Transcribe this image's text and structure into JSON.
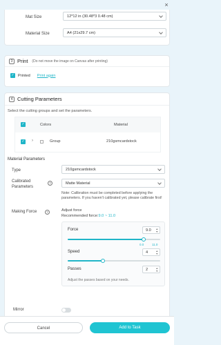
{
  "window": {
    "close_icon": "×"
  },
  "mat": {
    "mat_size_label": "Mat Size",
    "mat_size_value": "12*12 in (30.48*3 0.48 cm)",
    "material_size_label": "Material Size",
    "material_size_value": "A4 (21x29.7 cm)"
  },
  "print": {
    "number": "3",
    "title": "Print",
    "hint": "(Do not move the image on Canvas after printing)",
    "printed_label": "Printed",
    "print_again": "Print again"
  },
  "cutting": {
    "number": "4",
    "title": "Cutting Parameters",
    "subtitle": "Select the cutting groups and set the parameters.",
    "columns": [
      "Colors",
      "Material"
    ],
    "rows": [
      {
        "group": "Group",
        "material": "210gsmcardstock"
      }
    ]
  },
  "params": {
    "title": "Material Parameters",
    "type_label": "Type",
    "type_value": "210gsmcardstock",
    "calibrated_label": "Calibrated Parameters",
    "calibrated_value": "Matte Material",
    "note": "Note: Calibration must be completed before applying the parameters. If you haven't calibrated yet, please calibrate first!",
    "making_force_label": "Making Force",
    "adjust_force": "Adjust force",
    "recommended_prefix": "Recommended force:",
    "recommended_range": "9.0 ~ 11.0",
    "force_label": "Force",
    "force_value": "9.0",
    "force_min": "0.0",
    "force_max": "11.0",
    "force_fraction": 0.82,
    "speed_label": "Speed",
    "speed_value": "4",
    "speed_fraction": 0.38,
    "passes_label": "Passes",
    "passes_value": "2",
    "passes_hint": "Adjust the passes based on your needs.",
    "mirror_label": "Mirror"
  },
  "footer": {
    "cancel": "Cancel",
    "add_to_task": "Add to Task"
  },
  "colors": {
    "accent": "#1fb5c8",
    "button": "#1fc4d2"
  }
}
